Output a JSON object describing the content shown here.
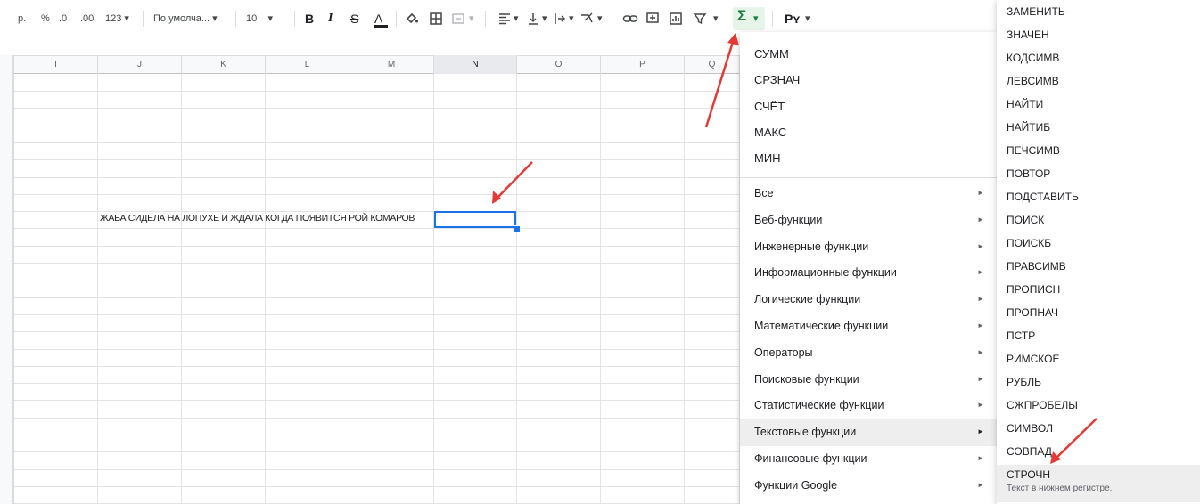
{
  "toolbar": {
    "currency": "р.",
    "percent": "%",
    "dec_decrease": ".0",
    "dec_increase": ".00",
    "more_formats": "123",
    "font_name": "По умолча...",
    "font_size": "10",
    "bold": "B",
    "italic": "I",
    "strike": "S",
    "text_color": "A",
    "fill_icon": "paint-bucket-icon",
    "borders_icon": "borders-icon",
    "merge_icon": "merge-cells-icon",
    "sigma": "Σ",
    "input_tool": "Рʏ"
  },
  "grid": {
    "columns": [
      "I",
      "J",
      "K",
      "L",
      "M",
      "N",
      "O",
      "P",
      "Q"
    ],
    "selected_column": "N",
    "cell_j_text": "ЖАБА СИДЕЛА НА ЛОПУХЕ И ЖДАЛА КОГДА ПОЯВИТСЯ РОЙ КОМАРОВ"
  },
  "function_menu": {
    "quick": [
      "СУММ",
      "СРЗНАЧ",
      "СЧЁТ",
      "МАКС",
      "МИН"
    ],
    "categories": [
      "Все",
      "Веб-функции",
      "Инженерные функции",
      "Информационные функции",
      "Логические функции",
      "Математические функции",
      "Операторы",
      "Поисковые функции",
      "Статистические функции",
      "Текстовые функции",
      "Финансовые функции",
      "Функции Google"
    ],
    "active_category": "Текстовые функции"
  },
  "text_submenu": {
    "items": [
      "ЗАМЕНИТЬ",
      "ЗНАЧЕН",
      "КОДСИМВ",
      "ЛЕВСИМВ",
      "НАЙТИ",
      "НАЙТИБ",
      "ПЕЧСИМВ",
      "ПОВТОР",
      "ПОДСТАВИТЬ",
      "ПОИСК",
      "ПОИСКБ",
      "ПРАВСИМВ",
      "ПРОПИСН",
      "ПРОПНАЧ",
      "ПСТР",
      "РИМСКОЕ",
      "РУБЛЬ",
      "СЖПРОБЕЛЫ",
      "СИМВОЛ",
      "СОВПАД",
      "СТРОЧН"
    ],
    "highlighted": "СТРОЧН",
    "highlighted_desc": "Текст в нижнем регистре."
  },
  "colors": {
    "accent": "#1a73e8",
    "arrow": "#e53935",
    "menu_active": "#eeeeee"
  }
}
